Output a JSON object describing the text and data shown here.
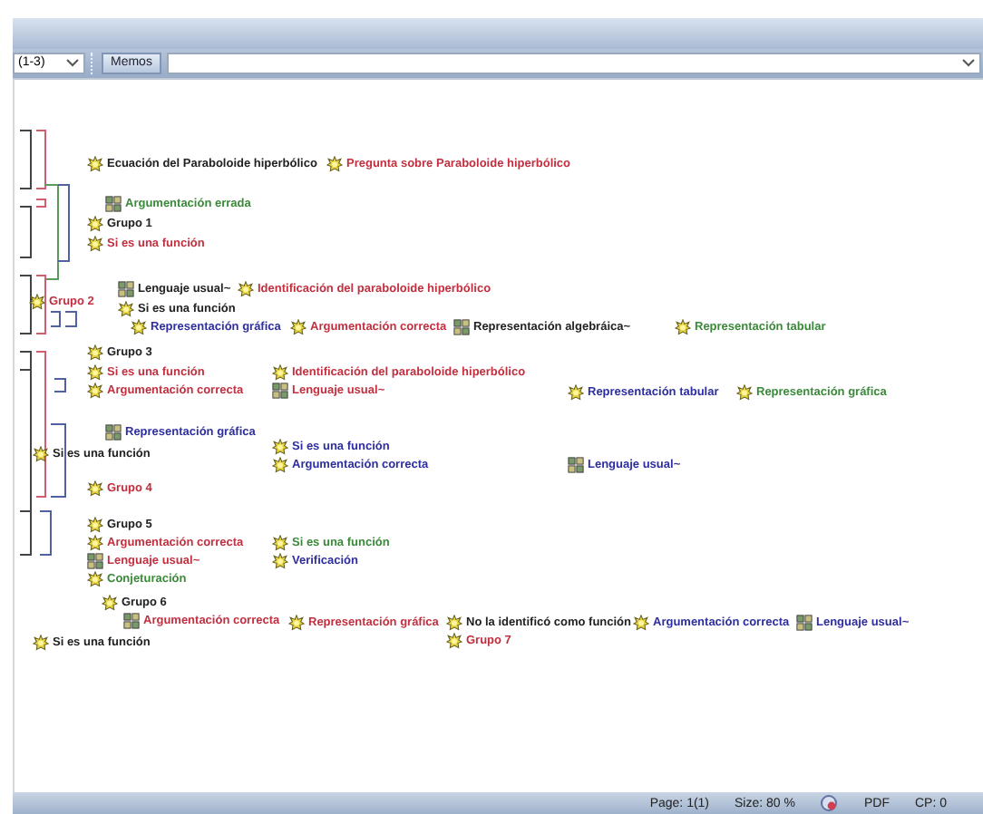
{
  "toolbar": {
    "filter": {
      "value": "(1-3)"
    },
    "memos_button": "Memos"
  },
  "nodes": [
    {
      "label": "Ecuación del Paraboloide hiperbólico",
      "kind": "code",
      "color": "#222222"
    },
    {
      "label": "Pregunta sobre Paraboloide hiperbólico",
      "kind": "code",
      "color": "#c23040"
    },
    {
      "label": "Argumentación errada",
      "kind": "network",
      "color": "#3a8a3a"
    },
    {
      "label": "Grupo 1",
      "kind": "code",
      "color": "#222222"
    },
    {
      "label": "Si es una función",
      "kind": "code",
      "color": "#c23040"
    },
    {
      "label": "Lenguaje usual~",
      "kind": "network",
      "color": "#222222"
    },
    {
      "label": "Identificación del paraboloide hiperbólico",
      "kind": "code",
      "color": "#c23040"
    },
    {
      "label": "Grupo 2",
      "kind": "code",
      "color": "#c23040"
    },
    {
      "label": "Si es una función",
      "kind": "code",
      "color": "#222222"
    },
    {
      "label": "Representación gráfica",
      "kind": "code",
      "color": "#2e2ea0"
    },
    {
      "label": "Argumentación correcta",
      "kind": "code",
      "color": "#c23040"
    },
    {
      "label": "Representación algebráica~",
      "kind": "network",
      "color": "#222222"
    },
    {
      "label": "Representación tabular",
      "kind": "code",
      "color": "#3a8a3a"
    },
    {
      "label": "Grupo 3",
      "kind": "code",
      "color": "#222222"
    },
    {
      "label": "Si es una función",
      "kind": "code",
      "color": "#c23040"
    },
    {
      "label": "Identificación del paraboloide hiperbólico",
      "kind": "code",
      "color": "#c23040"
    },
    {
      "label": "Argumentación correcta",
      "kind": "code",
      "color": "#c23040"
    },
    {
      "label": "Lenguaje usual~",
      "kind": "network",
      "color": "#c23040"
    },
    {
      "label": "Representación tabular",
      "kind": "code",
      "color": "#2e2ea0"
    },
    {
      "label": "Representación gráfica",
      "kind": "code",
      "color": "#3a8a3a"
    },
    {
      "label": "Representación gráfica",
      "kind": "network",
      "color": "#2e2ea0"
    },
    {
      "label": "Si es una función",
      "kind": "code",
      "color": "#222222"
    },
    {
      "label": "Si es una función",
      "kind": "code",
      "color": "#2e2ea0"
    },
    {
      "label": "Argumentación correcta",
      "kind": "code",
      "color": "#2e2ea0"
    },
    {
      "label": "Lenguaje usual~",
      "kind": "network",
      "color": "#2e2ea0"
    },
    {
      "label": "Grupo 4",
      "kind": "code",
      "color": "#c23040"
    },
    {
      "label": "Grupo 5",
      "kind": "code",
      "color": "#222222"
    },
    {
      "label": "Argumentación correcta",
      "kind": "code",
      "color": "#c23040"
    },
    {
      "label": "Si es una función",
      "kind": "code",
      "color": "#3a8a3a"
    },
    {
      "label": "Lenguaje usual~",
      "kind": "network",
      "color": "#c23040"
    },
    {
      "label": "Verificación",
      "kind": "code",
      "color": "#2e2ea0"
    },
    {
      "label": "Conjeturación",
      "kind": "code",
      "color": "#3a8a3a"
    },
    {
      "label": "Grupo 6",
      "kind": "code",
      "color": "#222222"
    },
    {
      "label": "Argumentación correcta",
      "kind": "network",
      "color": "#c23040"
    },
    {
      "label": "Representación gráfica",
      "kind": "code",
      "color": "#c23040"
    },
    {
      "label": "No la identificó como función",
      "kind": "code",
      "color": "#222222"
    },
    {
      "label": "Argumentación correcta",
      "kind": "code",
      "color": "#2e2ea0"
    },
    {
      "label": "Lenguaje usual~",
      "kind": "network",
      "color": "#2e2ea0"
    },
    {
      "label": "Si es una función",
      "kind": "code",
      "color": "#222222"
    },
    {
      "label": "Grupo 7",
      "kind": "code",
      "color": "#c23040"
    }
  ],
  "status_bar": [
    "Page: 1(1)",
    "Size: 80 %",
    "PDF",
    "CP: 0"
  ]
}
